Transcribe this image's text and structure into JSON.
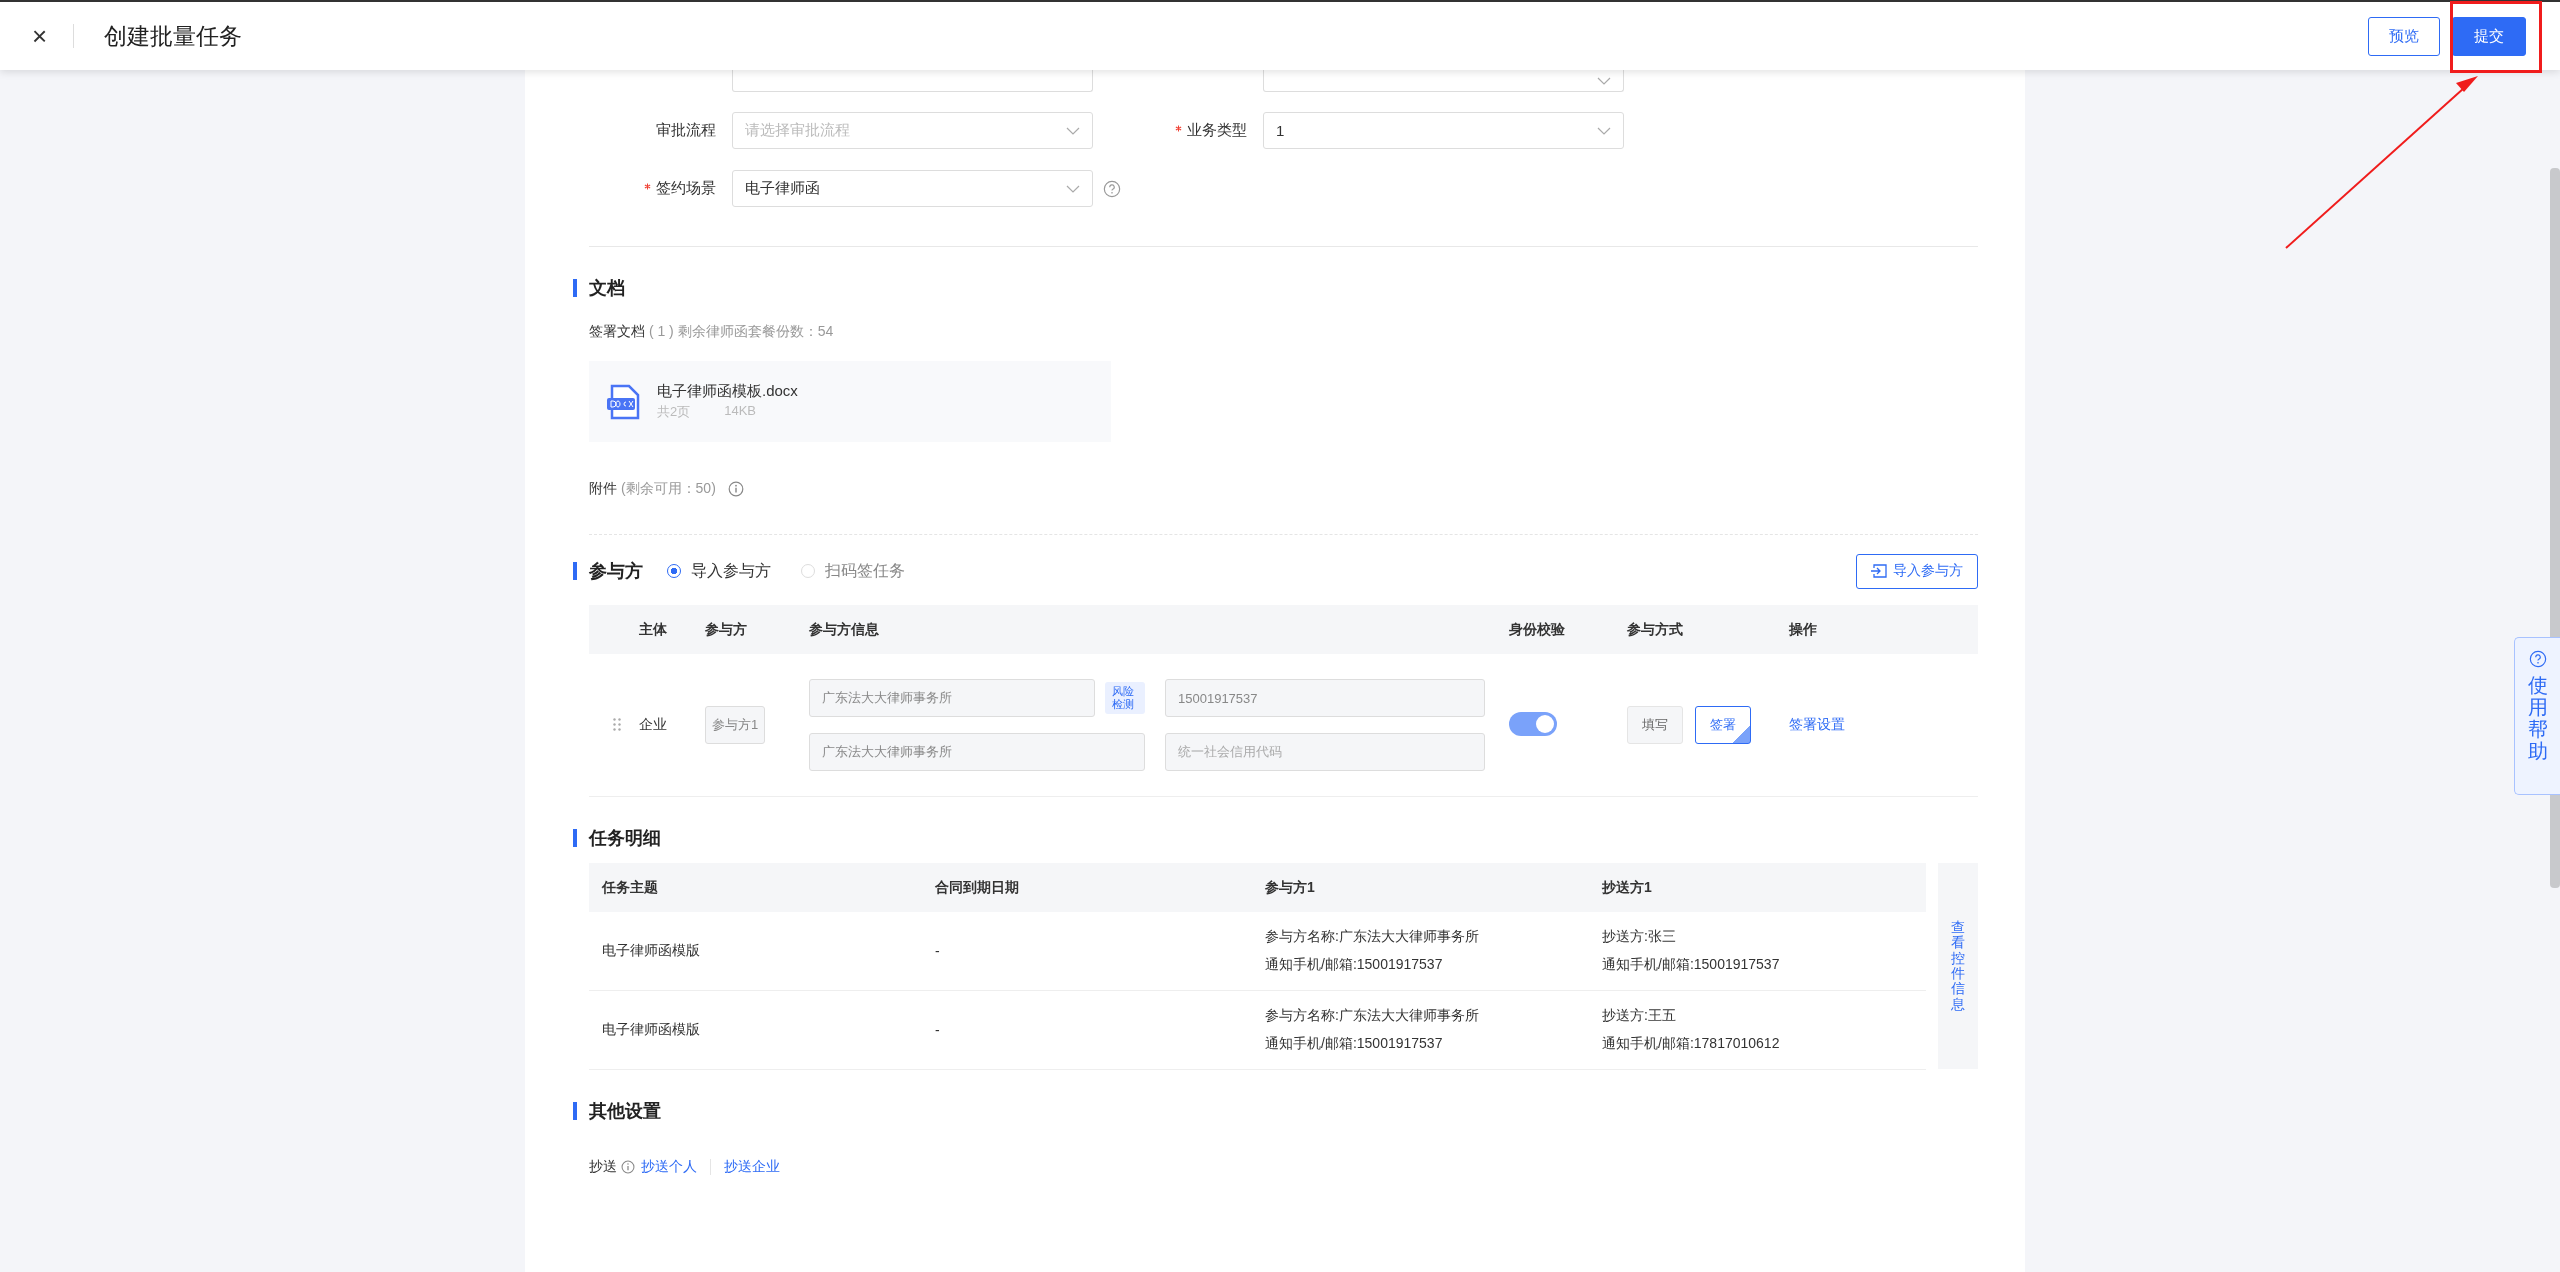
{
  "header": {
    "close": "×",
    "title": "创建批量任务",
    "buttons": [
      {
        "label": "预览",
        "kind": "secondary"
      },
      {
        "label": "提交",
        "kind": "primary"
      }
    ]
  },
  "form": {
    "rows": [
      [
        {
          "label": "审批流程",
          "required": false,
          "kind": "select",
          "placeholder": "请选择审批流程"
        },
        {
          "label": "业务类型",
          "required": true,
          "kind": "select",
          "value": "1"
        }
      ],
      [
        {
          "label": "签约场景",
          "required": true,
          "kind": "select",
          "value": "电子律师函",
          "help": true
        }
      ]
    ]
  },
  "documents": {
    "title": "文档",
    "signing_label": "签署文档",
    "signing_count": "( 1 )",
    "remaining": "剩余律师函套餐份数：54",
    "file": {
      "name": "电子律师函模板.docx",
      "pages": "共2页",
      "size": "14KB"
    },
    "attachment_label": "附件",
    "attachment_note": "(剩余可用：50)"
  },
  "participants": {
    "title": "参与方",
    "modes": [
      {
        "label": "导入参与方",
        "selected": true
      },
      {
        "label": "扫码签任务",
        "selected": false
      }
    ],
    "import_button": "导入参与方",
    "columns": [
      "主体",
      "参与方",
      "参与方信息",
      "身份校验",
      "参与方式",
      "操作"
    ],
    "rows": [
      {
        "subject": "企业",
        "party": "参与方1",
        "name": "广东法大大律师事务所",
        "risk": "风险检测",
        "contact": "15001917537",
        "org_name": "广东法大大律师事务所",
        "credit_placeholder": "统一社会信用代码",
        "identity_check": true,
        "methods": [
          {
            "label": "填写",
            "selected": false
          },
          {
            "label": "签署",
            "selected": true
          }
        ],
        "action": "签署设置"
      }
    ]
  },
  "tasks": {
    "title": "任务明细",
    "columns": [
      "任务主题",
      "合同到期日期",
      "参与方1",
      "抄送方1"
    ],
    "side_button": "查看控件信息",
    "rows": [
      {
        "subject": "电子律师函模版",
        "due": "-",
        "party": [
          "参与方名称:广东法大大律师事务所",
          "通知手机/邮箱:15001917537"
        ],
        "cc": [
          "抄送方:张三",
          "通知手机/邮箱:15001917537"
        ]
      },
      {
        "subject": "电子律师函模版",
        "due": "-",
        "party": [
          "参与方名称:广东法大大律师事务所",
          "通知手机/邮箱:15001917537"
        ],
        "cc": [
          "抄送方:王五",
          "通知手机/邮箱:17817010612"
        ]
      }
    ]
  },
  "other": {
    "title": "其他设置",
    "cc_label": "抄送",
    "links": [
      "抄送个人",
      "抄送企业"
    ]
  },
  "help": {
    "label": "使用帮助"
  }
}
